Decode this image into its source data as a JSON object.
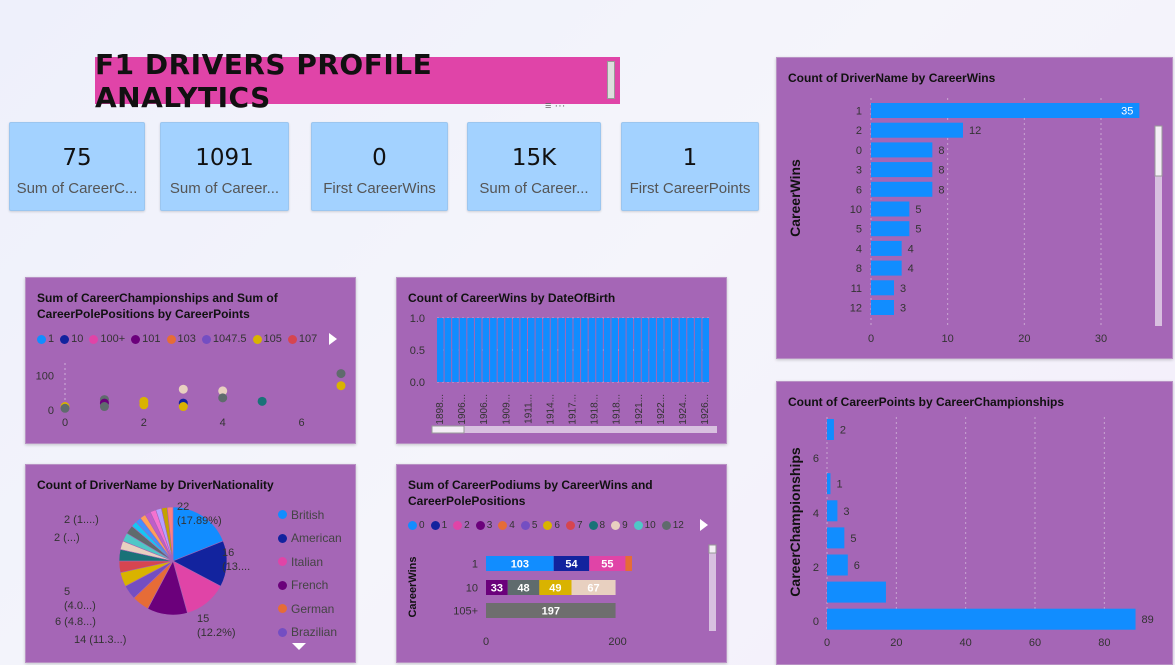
{
  "title": "F1 DRIVERS PROFILE ANALYTICS",
  "title_dots": "≡ ···",
  "cards": [
    {
      "value": "75",
      "label": "Sum of CareerC..."
    },
    {
      "value": "1091",
      "label": "Sum of Career..."
    },
    {
      "value": "0",
      "label": "First CareerWins"
    },
    {
      "value": "15K",
      "label": "Sum of Career..."
    },
    {
      "value": "1",
      "label": "First CareerPoints"
    }
  ],
  "scatter_panel": {
    "title_line1": "Sum of CareerChampionships and Sum of",
    "title_line2": "CareerPolePositions by CareerPoints",
    "legend": [
      {
        "label": "1",
        "color": "#118dff"
      },
      {
        "label": "10",
        "color": "#12239e"
      },
      {
        "label": "100+",
        "color": "#e044a7"
      },
      {
        "label": "101",
        "color": "#6b007b"
      },
      {
        "label": "103",
        "color": "#e66c37"
      },
      {
        "label": "1047.5",
        "color": "#744ec2"
      },
      {
        "label": "105",
        "color": "#d9b300"
      },
      {
        "label": "107",
        "color": "#d64550"
      }
    ]
  },
  "datebar_panel": {
    "title": "Count of CareerWins by DateOfBirth"
  },
  "pie_panel": {
    "title": "Count of DriverName by DriverNationality",
    "legend": [
      {
        "label": "British",
        "color": "#118dff"
      },
      {
        "label": "American",
        "color": "#12239e"
      },
      {
        "label": "Italian",
        "color": "#e044a7"
      },
      {
        "label": "French",
        "color": "#6b007b"
      },
      {
        "label": "German",
        "color": "#e66c37"
      },
      {
        "label": "Brazilian",
        "color": "#744ec2"
      }
    ]
  },
  "stacked_panel": {
    "title_line1": "Sum of CareerPodiums by CareerWins and",
    "title_line2": "CareerPolePositions",
    "legend": [
      {
        "label": "0",
        "color": "#118dff"
      },
      {
        "label": "1",
        "color": "#12239e"
      },
      {
        "label": "2",
        "color": "#e044a7"
      },
      {
        "label": "3",
        "color": "#6b007b"
      },
      {
        "label": "4",
        "color": "#e66c37"
      },
      {
        "label": "5",
        "color": "#744ec2"
      },
      {
        "label": "6",
        "color": "#d9b300"
      },
      {
        "label": "7",
        "color": "#d64550"
      },
      {
        "label": "8",
        "color": "#197278"
      },
      {
        "label": "9",
        "color": "#e8d0c0"
      },
      {
        "label": "10",
        "color": "#4fc7c7"
      },
      {
        "label": "12",
        "color": "#5f6b6d"
      }
    ]
  },
  "wins_panel": {
    "title": "Count of DriverName by CareerWins"
  },
  "champ_panel": {
    "title": "Count of CareerPoints by CareerChampionships"
  },
  "chart_data": [
    {
      "type": "bar",
      "title": "Count of DriverName by CareerWins",
      "ylabel": "CareerWins",
      "categories": [
        "1",
        "2",
        "0",
        "3",
        "6",
        "10",
        "5",
        "4",
        "8",
        "11",
        "12"
      ],
      "values": [
        35,
        12,
        8,
        8,
        8,
        5,
        5,
        4,
        4,
        3,
        3
      ],
      "xticks": [
        "0",
        "10",
        "20",
        "30"
      ],
      "xlim": [
        0,
        36
      ]
    },
    {
      "type": "bar",
      "title": "Count of CareerPoints by CareerChampionships",
      "ylabel": "CareerChampionships",
      "categories": [
        "7",
        "6",
        "5",
        "4",
        "3",
        "2",
        "1",
        "0"
      ],
      "values": [
        2,
        0,
        1,
        3,
        5,
        6,
        17,
        89
      ],
      "data_labels": [
        "2",
        "",
        "1",
        "3",
        "5",
        "6",
        "",
        "89"
      ],
      "yticks": [
        "6",
        "4",
        "2",
        "0"
      ],
      "xticks": [
        "0",
        "20",
        "40",
        "60",
        "80"
      ],
      "xlim": [
        0,
        90
      ]
    },
    {
      "type": "bar",
      "title": "Count of CareerWins by DateOfBirth",
      "yticks": [
        "1.0",
        "0.5",
        "0.0"
      ],
      "ylim": [
        0,
        1
      ],
      "xticks": [
        "1898...",
        "1906...",
        "1906...",
        "1909...",
        "1911...",
        "1914...",
        "1917...",
        "1918...",
        "1918...",
        "1921...",
        "1922...",
        "1924...",
        "1926..."
      ],
      "bar_count": 36,
      "value": 1.0
    },
    {
      "type": "scatter",
      "title": "Sum of CareerChampionships and Sum of CareerPolePositions by CareerPoints",
      "xticks": [
        "0",
        "2",
        "4",
        "6"
      ],
      "yticks": [
        "100",
        "0"
      ],
      "xlim": [
        0,
        7
      ],
      "ylim": [
        0,
        150
      ],
      "points": [
        {
          "x": 0,
          "y": 10,
          "color": "#d9b300"
        },
        {
          "x": 0,
          "y": 5,
          "color": "#5f6b6d"
        },
        {
          "x": 1,
          "y": 30,
          "color": "#5f6b6d"
        },
        {
          "x": 1,
          "y": 20,
          "color": "#6b007b"
        },
        {
          "x": 1,
          "y": 10,
          "color": "#5f6b6d"
        },
        {
          "x": 2,
          "y": 25,
          "color": "#d9b300"
        },
        {
          "x": 2,
          "y": 15,
          "color": "#d9b300"
        },
        {
          "x": 3,
          "y": 60,
          "color": "#e8d0c0"
        },
        {
          "x": 3,
          "y": 20,
          "color": "#12239e"
        },
        {
          "x": 3,
          "y": 10,
          "color": "#d9b300"
        },
        {
          "x": 4,
          "y": 55,
          "color": "#e8d0c0"
        },
        {
          "x": 4,
          "y": 35,
          "color": "#5f6b6d"
        },
        {
          "x": 5,
          "y": 25,
          "color": "#197278"
        },
        {
          "x": 7,
          "y": 105,
          "color": "#5f6b6d"
        },
        {
          "x": 7,
          "y": 70,
          "color": "#d9b300"
        }
      ]
    },
    {
      "type": "pie",
      "title": "Count of DriverName by DriverNationality",
      "slices": [
        {
          "label": "British",
          "value": 22,
          "color": "#118dff"
        },
        {
          "label": "American",
          "value": 16,
          "color": "#12239e"
        },
        {
          "label": "Italian",
          "value": 15,
          "color": "#e044a7"
        },
        {
          "label": "French",
          "value": 14,
          "color": "#6b007b"
        },
        {
          "label": "German",
          "value": 6,
          "color": "#e66c37"
        },
        {
          "label": "Brazilian",
          "value": 5,
          "color": "#744ec2"
        },
        {
          "label": "",
          "value": 5,
          "color": "#d9b300"
        },
        {
          "label": "",
          "value": 4,
          "color": "#d64550"
        },
        {
          "label": "",
          "value": 4,
          "color": "#197278"
        },
        {
          "label": "",
          "value": 3,
          "color": "#e8d0c0"
        },
        {
          "label": "",
          "value": 3,
          "color": "#4fc7c7"
        },
        {
          "label": "",
          "value": 3,
          "color": "#5f6b6d"
        },
        {
          "label": "",
          "value": 2,
          "color": "#15c6f4"
        },
        {
          "label": "",
          "value": 2,
          "color": "#4092ff"
        },
        {
          "label": "",
          "value": 2,
          "color": "#ffa058"
        },
        {
          "label": "",
          "value": 2,
          "color": "#be5dc9"
        },
        {
          "label": "",
          "value": 2,
          "color": "#f472d0"
        },
        {
          "label": "",
          "value": 2,
          "color": "#b5a1ff"
        },
        {
          "label": "",
          "value": 2,
          "color": "#c4a200"
        },
        {
          "label": "",
          "value": 2,
          "color": "#ff8080"
        }
      ],
      "data_labels": [
        {
          "value": "22",
          "pct": "(17.89%)"
        },
        {
          "value": "16",
          "pct": "(13...."
        },
        {
          "value": "15",
          "pct": "(12.2%)"
        },
        {
          "value": "14 (11.3...)",
          "pct": ""
        },
        {
          "value": "6 (4.8...)",
          "pct": ""
        },
        {
          "value": "5",
          "pct": "(4.0...)"
        },
        {
          "value": "2 (...)",
          "pct": ""
        },
        {
          "value": "2 (1....)",
          "pct": ""
        }
      ]
    },
    {
      "type": "bar",
      "title": "Sum of CareerPodiums by CareerWins and CareerPolePositions",
      "ylabel": "CareerWins",
      "categories": [
        "1",
        "10",
        "105+"
      ],
      "segments": [
        [
          {
            "value": 103,
            "color": "#118dff"
          },
          {
            "value": 54,
            "color": "#12239e"
          },
          {
            "value": 55,
            "color": "#e044a7"
          },
          {
            "value": 10,
            "color": "#e66c37"
          }
        ],
        [
          {
            "value": 33,
            "color": "#6b007b"
          },
          {
            "value": 48,
            "color": "#5f6b6d"
          },
          {
            "value": 49,
            "color": "#d9b300"
          },
          {
            "value": 67,
            "color": "#e8d0c0"
          }
        ],
        [
          {
            "value": 197,
            "color": "#6e6e6e"
          }
        ]
      ],
      "segment_labels": [
        [
          "103",
          "54",
          "55",
          ""
        ],
        [
          "33",
          "48",
          "49",
          "67"
        ],
        [
          "197"
        ]
      ],
      "xticks": [
        "0",
        "200"
      ],
      "xlim": [
        0,
        222
      ]
    }
  ]
}
